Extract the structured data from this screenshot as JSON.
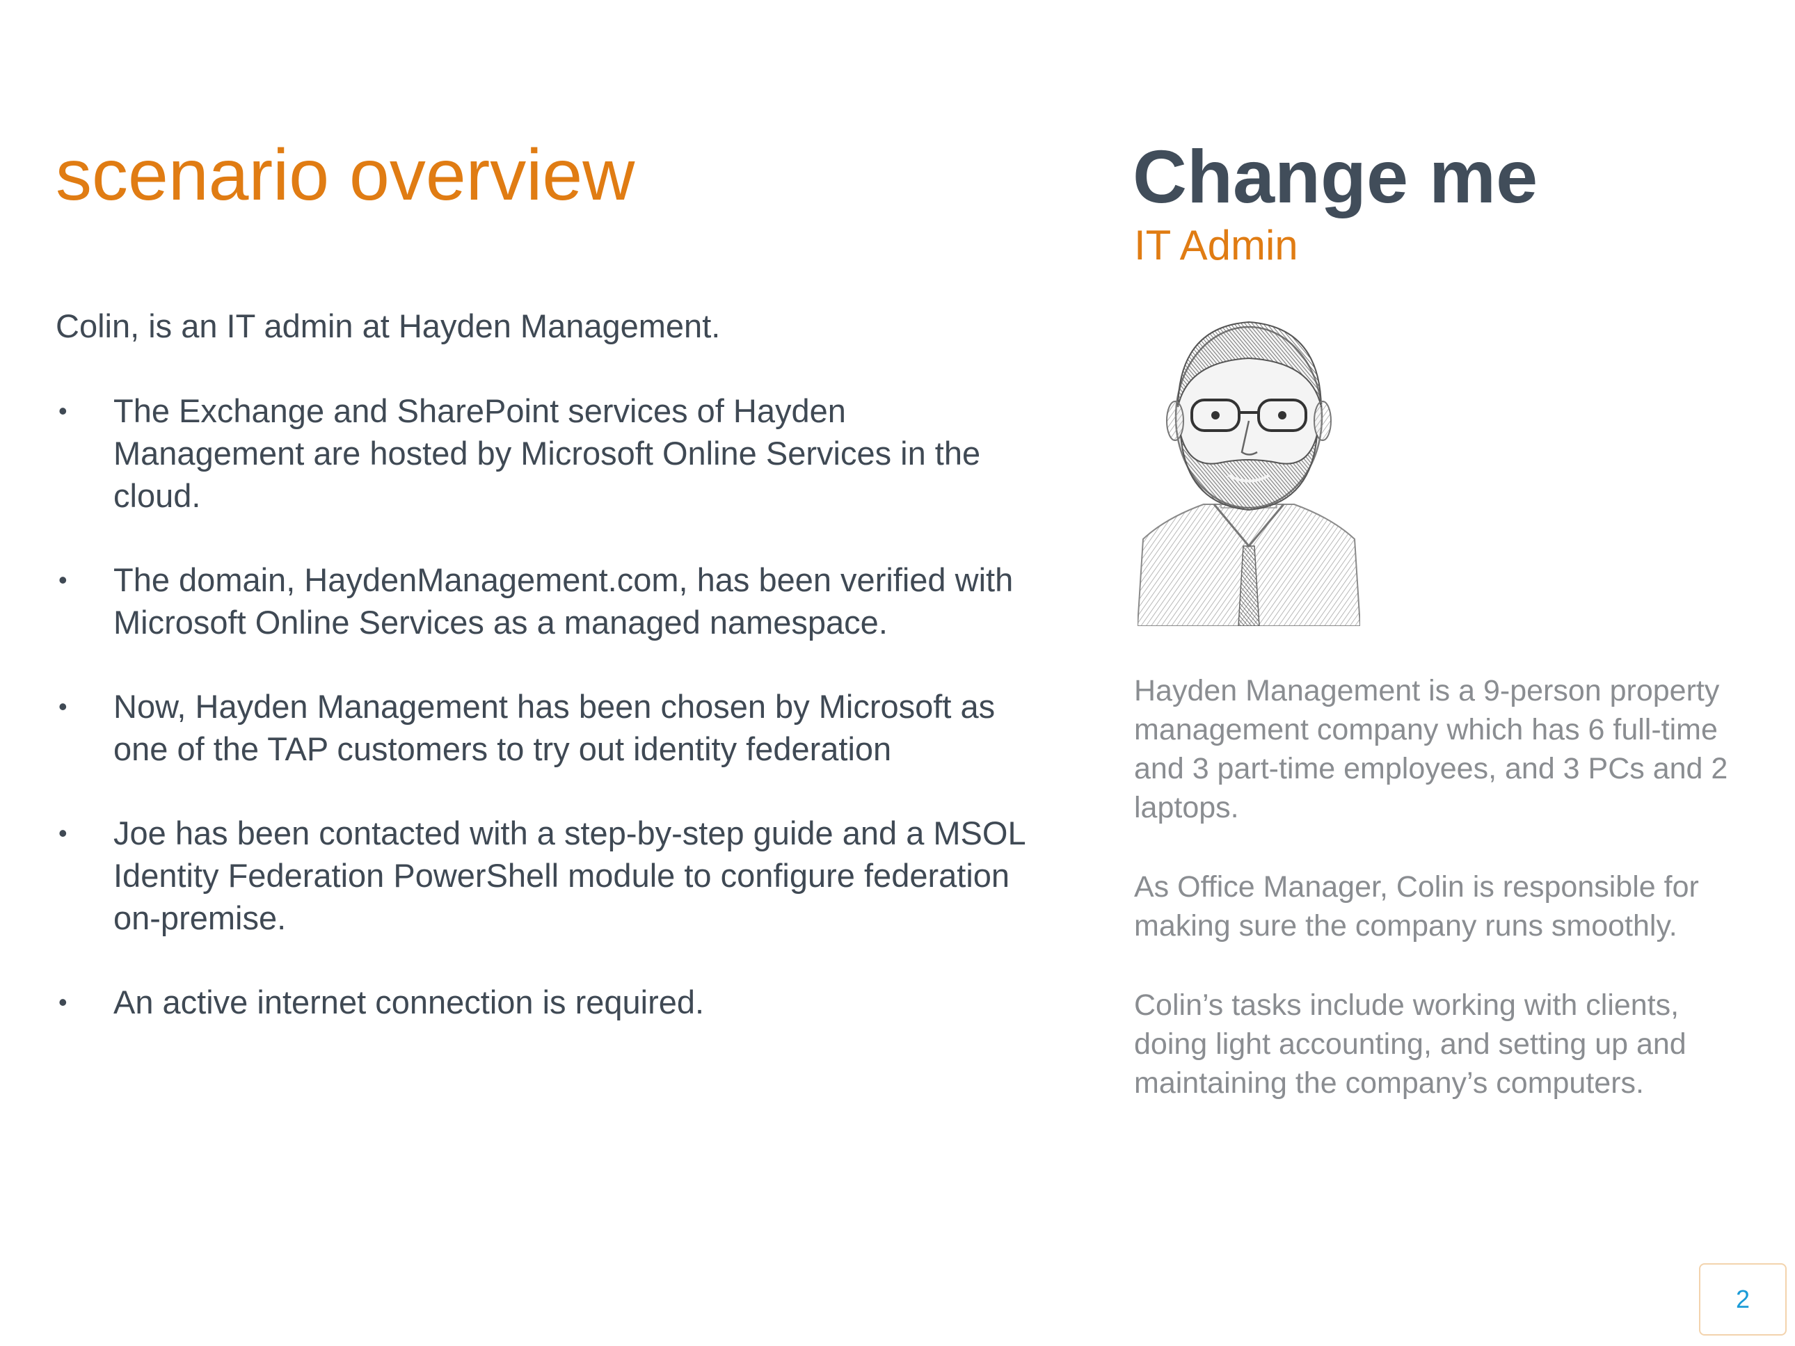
{
  "slide": {
    "title": "scenario overview",
    "intro": "Colin, is an IT admin at Hayden Management.",
    "bullet_glyph": "•",
    "bullets": [
      "The Exchange and SharePoint services of Hayden Management are hosted by Microsoft Online Services in the cloud.",
      "The domain, HaydenManagement.com, has been verified with Microsoft Online Services as a managed namespace.",
      "Now, Hayden Management has been chosen by Microsoft as one of the TAP customers to try out identity federation",
      "Joe has been contacted with a step-by-step guide and a MSOL Identity Federation PowerShell module to configure federation on-premise.",
      "An active internet connection is required."
    ]
  },
  "persona": {
    "name": "Change me",
    "role": "IT Admin",
    "portrait_icon": "persona-sketch-icon",
    "description": [
      "Hayden Management is a 9-person property management company which has 6 full-time and 3 part-time employees, and 3 PCs and 2 laptops.",
      "As Office Manager, Colin is responsible for making sure the company runs smoothly.",
      "Colin’s tasks include working with clients, doing light accounting, and setting up and maintaining the company’s computers."
    ]
  },
  "footer": {
    "page_number": "2"
  },
  "colors": {
    "accent_orange": "#E07C13",
    "heading_slate": "#414d5a",
    "body_text": "#3f4954",
    "muted_text": "#8a8d91",
    "page_number_blue": "#1a9bd7",
    "page_box_border": "#f3d3ad"
  }
}
